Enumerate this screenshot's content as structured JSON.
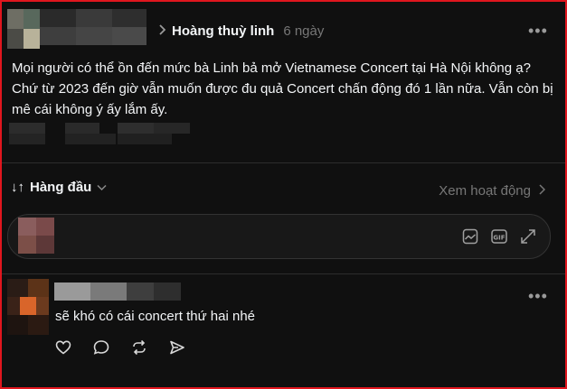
{
  "post": {
    "author": "Hoàng thuỳ linh",
    "time": "6 ngày",
    "body": "Mọi người có thể ồn đến mức bà Linh bả mở Vietnamese Concert tại Hà Nội không ạ? Chứ từ 2023 đến giờ vẫn muốn được đu quả Concert chấn động đó 1 lần nữa. Vẫn còn bị mê cái không ý ấy lắm ấy.",
    "more_label": "•••"
  },
  "replies": {
    "sort_label": "Hàng đầu",
    "activity_label": "Xem hoạt động"
  },
  "composer": {
    "icons": [
      "image-icon",
      "gif-icon",
      "expand-icon"
    ]
  },
  "comment": {
    "text": "sẽ khó có cái concert thứ hai nhé",
    "more_label": "•••",
    "actions": [
      "like-icon",
      "reply-icon",
      "repost-icon",
      "share-icon"
    ]
  },
  "colors": {
    "background": "#101010",
    "text": "#f3f5f7",
    "muted": "#777777",
    "border": "#e0161e"
  }
}
